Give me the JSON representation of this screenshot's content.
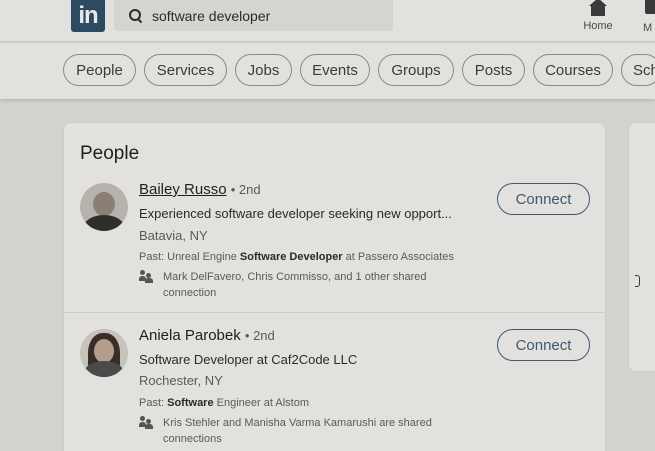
{
  "nav": {
    "logo": "in",
    "search_value": "software developer",
    "home_label": "Home",
    "more_label": "M"
  },
  "filters": [
    "People",
    "Services",
    "Jobs",
    "Events",
    "Groups",
    "Posts",
    "Courses",
    "Sch"
  ],
  "results_card": {
    "title": "People",
    "people": [
      {
        "name": "Bailey Russo",
        "degree": "• 2nd",
        "headline": "Experienced software developer seeking new opport...",
        "location": "Batavia, NY",
        "past_prefix": "Past: Unreal Engine ",
        "past_bold": "Software Developer",
        "past_suffix": " at Passero Associates",
        "shared_line1": "Mark DelFavero, Chris Commisso, and 1 other shared",
        "shared_line2": "connection",
        "connect_label": "Connect"
      },
      {
        "name": "Aniela Parobek",
        "degree": "• 2nd",
        "headline": "Software Developer at Caf2Code LLC",
        "location": "Rochester, NY",
        "past_prefix": "Past: ",
        "past_bold": "Software",
        "past_suffix": " Engineer at Alstom",
        "shared_line1": "Kris Stehler and Manisha Varma Kamarushi are shared",
        "shared_line2": "connections",
        "connect_label": "Connect"
      }
    ]
  },
  "colors": {
    "overlay_bg": "#d4d2cd",
    "card_bg": "#e2e1dd",
    "brand": "#2d4a63",
    "connect_accent": "#3f5871"
  }
}
